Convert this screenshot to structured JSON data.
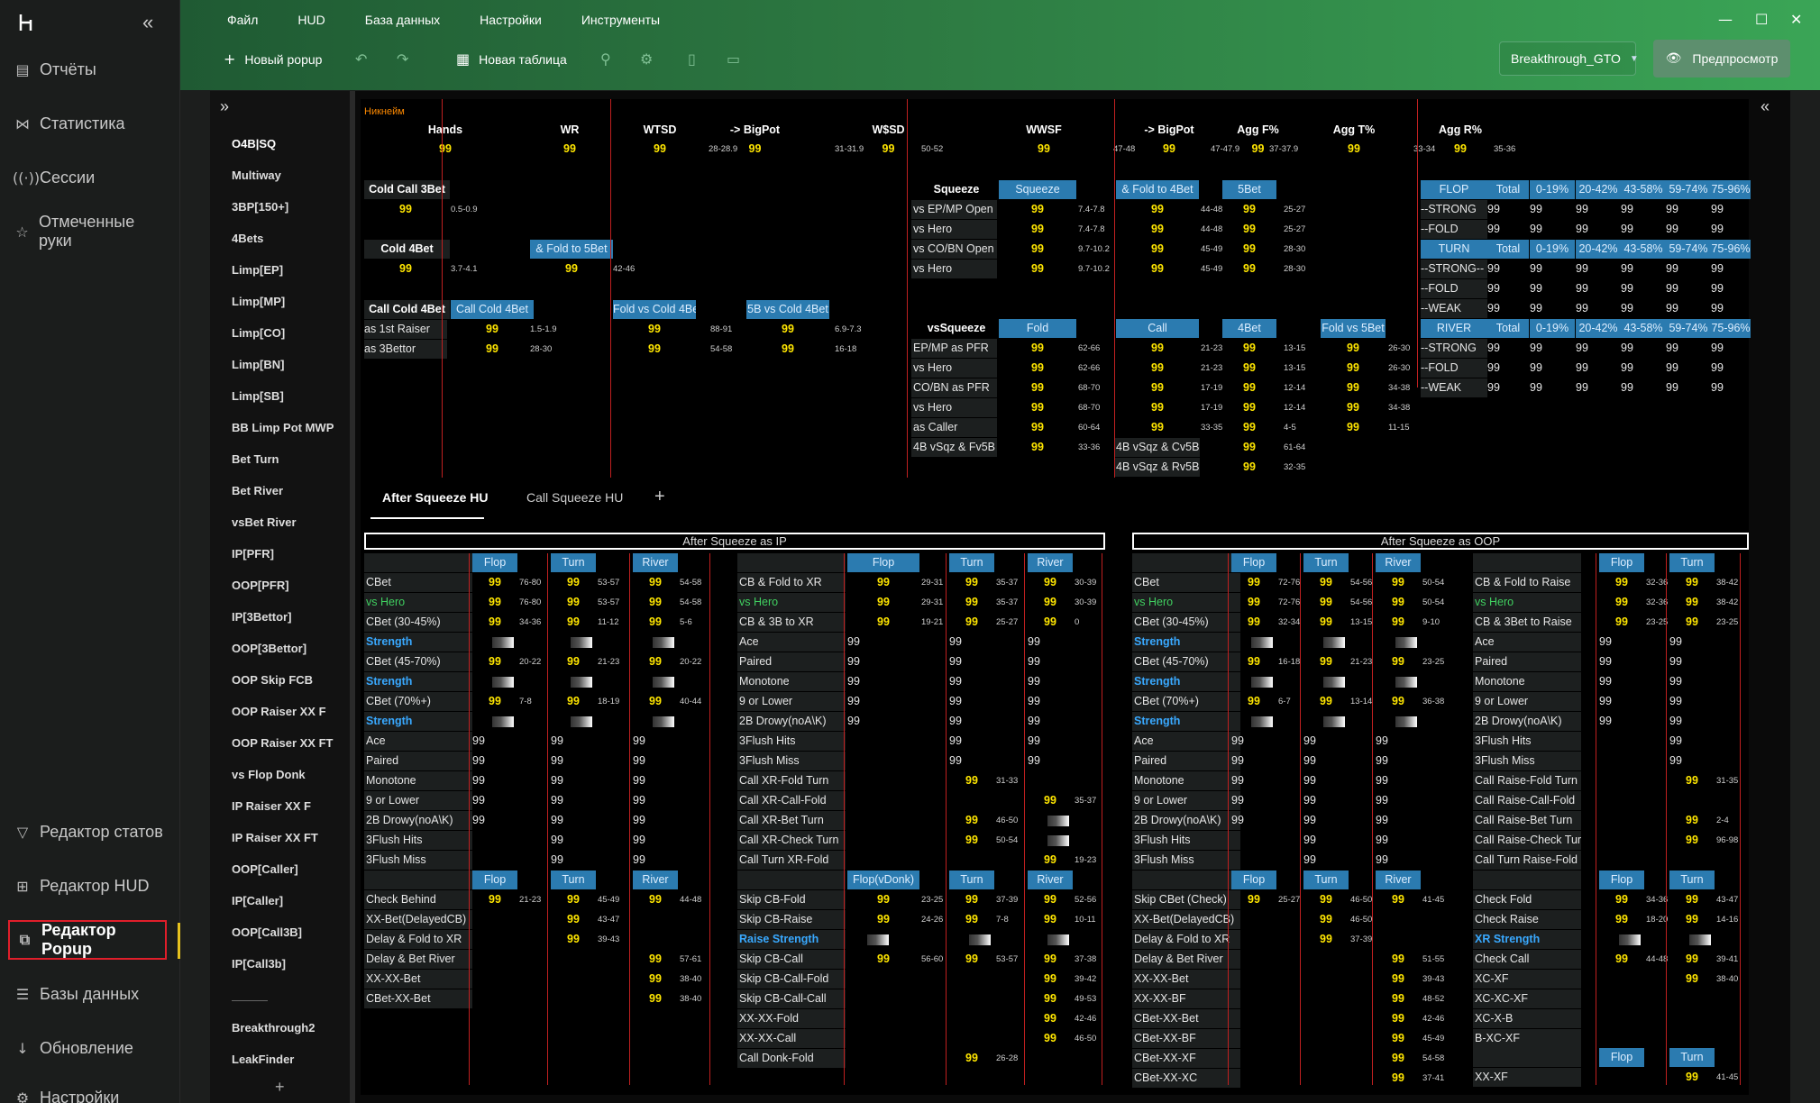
{
  "app": {
    "collapse_glyph": "«"
  },
  "sidebar": {
    "items": [
      {
        "label": "Отчёты",
        "icon": "report-icon"
      },
      {
        "label": "Статистика",
        "icon": "stats-icon"
      },
      {
        "label": "Сессии",
        "icon": "sessions-icon"
      },
      {
        "label": "Отмеченные руки",
        "icon": "marked-hands-icon"
      },
      {
        "label": "Редактор статов",
        "icon": "filter-icon"
      },
      {
        "label": "Редактор HUD",
        "icon": "hud-icon"
      },
      {
        "label": "Редактор Popup",
        "icon": "popup-icon"
      },
      {
        "label": "Базы данных",
        "icon": "database-icon"
      },
      {
        "label": "Обновление",
        "icon": "download-icon"
      },
      {
        "label": "Настройки",
        "icon": "gear-icon"
      }
    ]
  },
  "menu": [
    "Файл",
    "HUD",
    "База данных",
    "Настройки",
    "Инструменты"
  ],
  "toolbar": {
    "new_popup": "Новый popup",
    "new_table": "Новая таблица",
    "profile": "Breakthrough_GTO",
    "preview": "Предпросмотр"
  },
  "left_list": {
    "items": [
      "O4B|SQ",
      "Multiway",
      "3BP[150+]",
      "4Bets",
      "Limp[EP]",
      "Limp[MP]",
      "Limp[CO]",
      "Limp[BN]",
      "Limp[SB]",
      "BB Limp Pot MWP",
      "Bet Turn",
      "Bet River",
      "vsBet River",
      "IP[PFR]",
      "OOP[PFR]",
      "IP[3Bettor]",
      "OOP[3Bettor]",
      "OOP Skip FCB",
      "OOP Raiser XX F",
      "OOP Raiser XX FT",
      "vs Flop Donk",
      "IP Raiser XX F",
      "IP Raiser XX FT",
      "OOP[Caller]",
      "IP[Caller]",
      "OOP[Call3B]",
      "IP[Call3b]",
      "Breakthrough2",
      "LeakFinder"
    ]
  },
  "header_stats": {
    "nickname": "Никнейм",
    "cols": [
      "Hands",
      "WR",
      "WTSD",
      "-> BigPot",
      "W$SD",
      "WWSF",
      "-> BigPot",
      "Agg F%",
      "Agg T%",
      "Agg R%"
    ],
    "value": "99",
    "ranges": [
      "28-28.9",
      "31-31.9",
      "50-52",
      "47-48",
      "47-47.9",
      "37-37.9",
      "33-34",
      "35-36"
    ]
  },
  "tabs": [
    "After Squeeze HU",
    "Call Squeeze HU"
  ],
  "sections": {
    "ip": "After Squeeze as IP",
    "oop": "After Squeeze as OOP"
  }
}
